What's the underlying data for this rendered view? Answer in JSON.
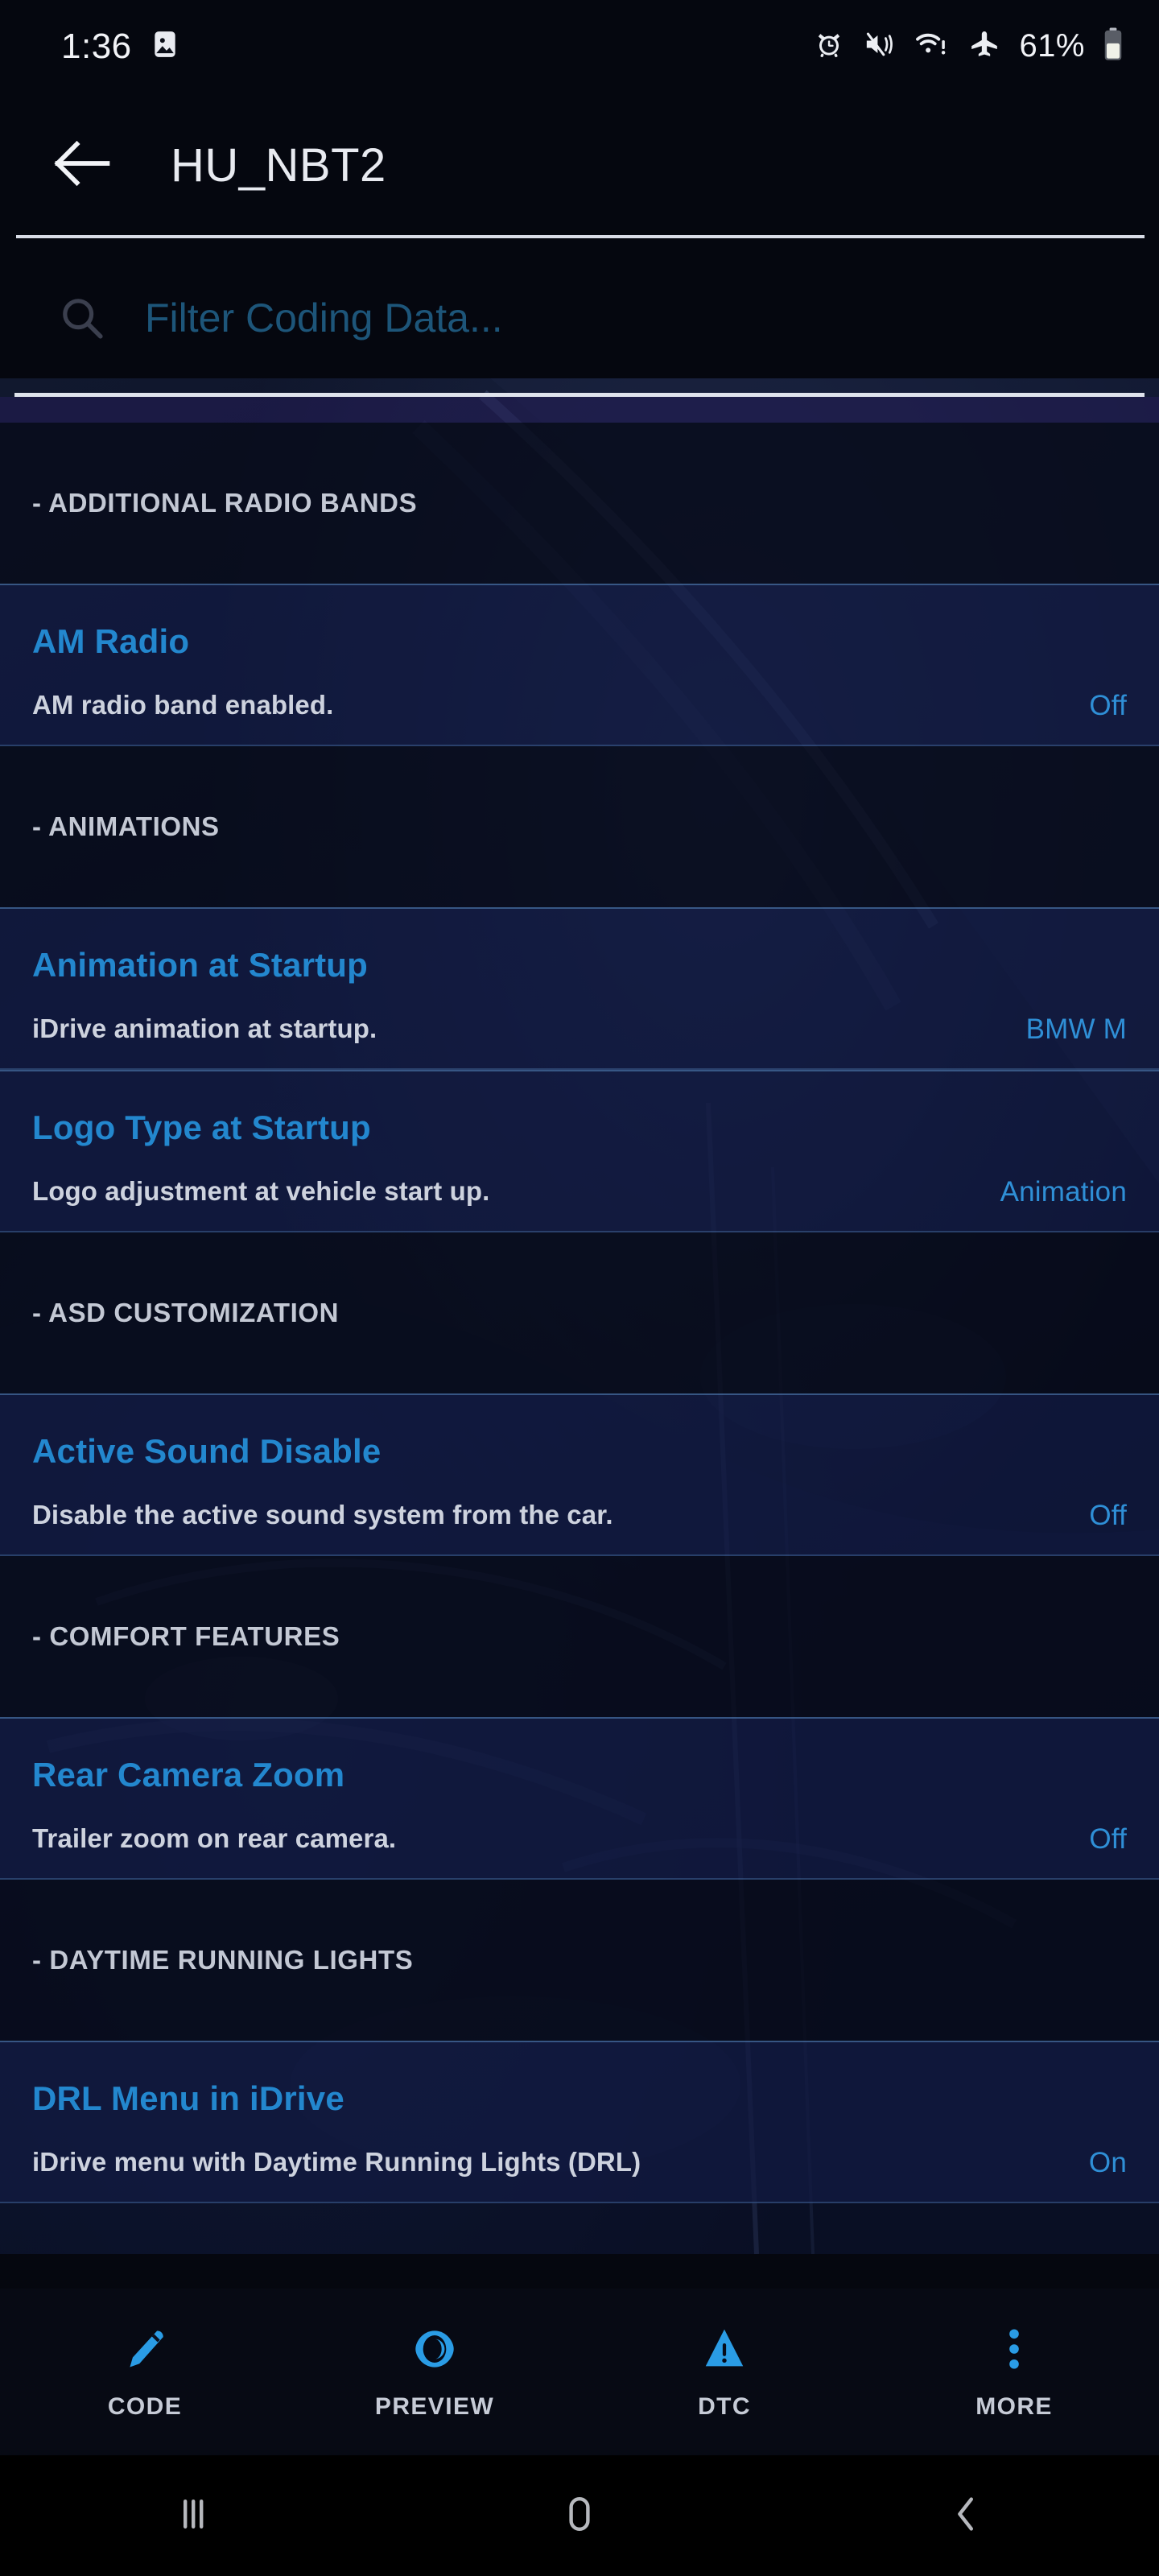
{
  "status_bar": {
    "time": "1:36",
    "battery_percent": "61%",
    "icons": [
      "image-icon",
      "alarm-icon",
      "mute-vibrate-icon",
      "wifi-alert-icon",
      "airplane-mode-icon",
      "battery-icon"
    ]
  },
  "app_bar": {
    "back_icon": "back-arrow-icon",
    "title": "HU_NBT2"
  },
  "search": {
    "icon": "search-icon",
    "placeholder": "Filter Coding Data...",
    "value": ""
  },
  "colors": {
    "accent_blue": "#2387ce",
    "value_blue": "#2f8fd6",
    "row_bg": "#121a42",
    "section_bg": "#080b1a",
    "divider": "#5688be"
  },
  "list": [
    {
      "type": "section",
      "label": "- ADDITIONAL RADIO BANDS"
    },
    {
      "type": "item",
      "title": "AM Radio",
      "description": "AM radio band enabled.",
      "value": "Off"
    },
    {
      "type": "section",
      "label": "- ANIMATIONS"
    },
    {
      "type": "item",
      "title": "Animation at Startup",
      "description": "iDrive animation at startup.",
      "value": "BMW M"
    },
    {
      "type": "item",
      "title": "Logo Type at Startup",
      "description": "Logo adjustment at vehicle start up.",
      "value": "Animation"
    },
    {
      "type": "section",
      "label": "- ASD CUSTOMIZATION"
    },
    {
      "type": "item",
      "title": "Active Sound Disable",
      "description": "Disable the active sound system from the car.",
      "value": "Off"
    },
    {
      "type": "section",
      "label": "- COMFORT FEATURES"
    },
    {
      "type": "item",
      "title": "Rear Camera Zoom",
      "description": "Trailer zoom on rear camera.",
      "value": "Off"
    },
    {
      "type": "section",
      "label": "- DAYTIME RUNNING LIGHTS"
    },
    {
      "type": "item",
      "title": "DRL Menu in iDrive",
      "description": "iDrive menu with Daytime Running Lights (DRL)",
      "value": "On"
    }
  ],
  "bottom_nav": [
    {
      "label": "CODE",
      "icon": "pencil-icon"
    },
    {
      "label": "PREVIEW",
      "icon": "eye-icon"
    },
    {
      "label": "DTC",
      "icon": "warning-triangle-icon"
    },
    {
      "label": "MORE",
      "icon": "overflow-dots-icon"
    }
  ],
  "system_nav": [
    {
      "name": "recents",
      "icon": "recents-icon"
    },
    {
      "name": "home",
      "icon": "home-icon"
    },
    {
      "name": "back",
      "icon": "back-chevron-icon"
    }
  ]
}
